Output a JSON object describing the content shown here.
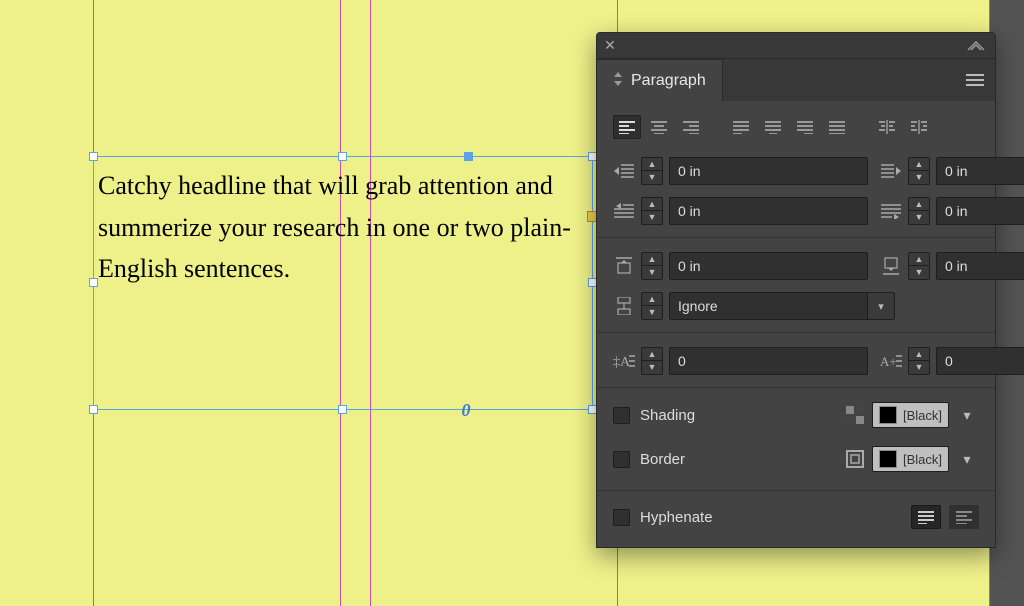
{
  "canvas": {
    "verticalGuides": [
      93,
      340,
      370,
      617,
      989
    ],
    "textFrame": {
      "content": "Catchy headline that will grab attention and summerize your research in one or two plain-English sentences.",
      "baselineGlyph": "0"
    }
  },
  "panel": {
    "title": "Paragraph",
    "indents": {
      "leftIndent": "0 in",
      "rightIndent": "0 in",
      "firstLineIndent": "0 in",
      "lastLineRightIndent": "0 in",
      "spaceBefore": "0 in",
      "spaceAfter": "0 in",
      "spaceBetween": "Ignore"
    },
    "dropCap": {
      "lines": "0",
      "chars": "0"
    },
    "shading": {
      "label": "Shading",
      "swatch": "[Black]"
    },
    "border": {
      "label": "Border",
      "swatch": "[Black]"
    },
    "hyphenate": {
      "label": "Hyphenate"
    }
  }
}
